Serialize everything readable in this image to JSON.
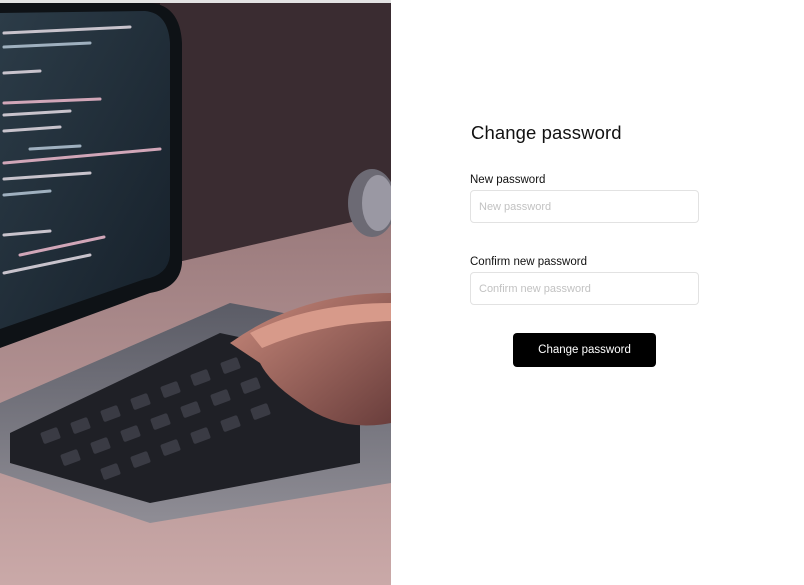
{
  "hero": {
    "alt": "laptop-with-code-image"
  },
  "form": {
    "title": "Change password",
    "new_password": {
      "label": "New password",
      "placeholder": "New password",
      "value": ""
    },
    "confirm_password": {
      "label": "Confirm new password",
      "placeholder": "Confirm new password",
      "value": ""
    },
    "submit_label": "Change password"
  },
  "colors": {
    "button_bg": "#000000",
    "button_text": "#ffffff",
    "field_border": "#e2e2e2",
    "placeholder": "#c2c2c2"
  }
}
